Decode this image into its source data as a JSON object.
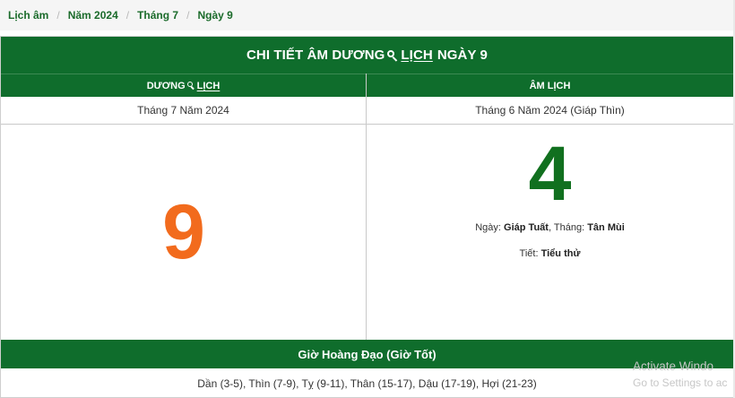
{
  "breadcrumb": {
    "items": [
      "Lịch âm",
      "Năm 2024",
      "Tháng 7",
      "Ngày 9"
    ],
    "separator": "/"
  },
  "title": {
    "before": "CHI TIẾT ÂM DƯƠNG",
    "linked": "LỊCH",
    "after": "NGÀY 9"
  },
  "solar": {
    "header_before": "DƯƠNG",
    "header_linked": "LỊCH",
    "month_year": "Tháng 7 Năm 2024",
    "day": "9"
  },
  "lunar": {
    "header": "ÂM LỊCH",
    "month_year": "Tháng 6 Năm 2024 (Giáp Thìn)",
    "day": "4",
    "day_label": "Ngày:",
    "day_value": "Giáp Tuất",
    "month_label": "Tháng:",
    "month_value": "Tân Mùi",
    "term_label": "Tiết:",
    "term_value": "Tiểu thử"
  },
  "gio_hoang_dao": {
    "header": "Giờ Hoàng Đạo (Giờ Tốt)",
    "list": "Dần (3-5), Thìn (7-9), Tỵ (9-11), Thân (15-17), Dậu (17-19), Hợi (21-23)"
  },
  "watermark": {
    "line1": "Activate Windo",
    "line2": "Go to Settings to ac"
  },
  "colors": {
    "green": "#0f6d2c",
    "solar_day": "#f26b1d",
    "lunar_day": "#11701f"
  },
  "icons": [
    "search-icon"
  ]
}
